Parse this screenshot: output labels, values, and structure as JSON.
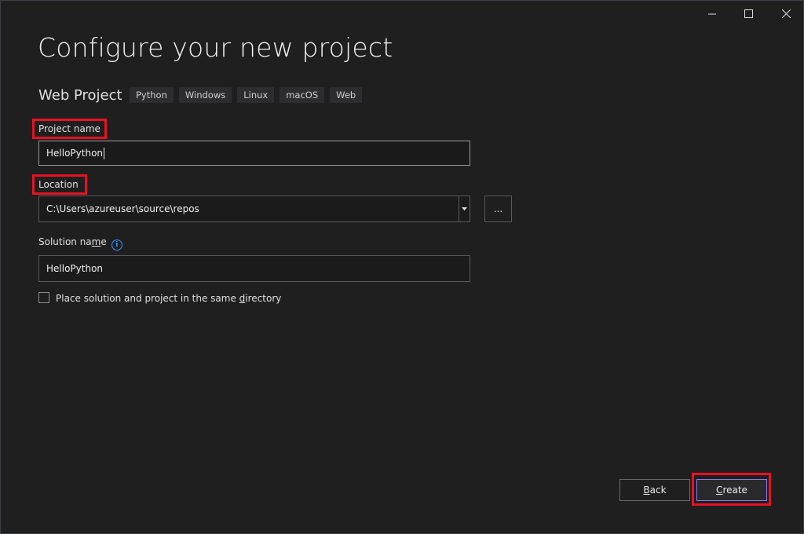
{
  "window": {
    "controls": [
      "minimize-icon",
      "maximize-icon",
      "close-icon"
    ]
  },
  "header": {
    "title": "Configure your new project",
    "template_name": "Web Project",
    "tags": [
      "Python",
      "Windows",
      "Linux",
      "macOS",
      "Web"
    ]
  },
  "form": {
    "project_name_label": "Project name",
    "project_name_value": "HelloPython",
    "location_label": "Location",
    "location_value": "C:\\Users\\azureuser\\source\\repos",
    "browse_label": "...",
    "solution_name_label_pre": "Solution na",
    "solution_name_label_ul": "m",
    "solution_name_label_post": "e",
    "solution_name_value": "HelloPython",
    "same_dir_label_pre": "Place solution and project in the same ",
    "same_dir_label_ul": "d",
    "same_dir_label_post": "irectory",
    "same_dir_checked": false
  },
  "footer": {
    "back_label_ul": "B",
    "back_label_rest": "ack",
    "create_label_ul": "C",
    "create_label_rest": "reate"
  },
  "colors": {
    "background": "#1f1f1f",
    "highlight": "#e81123",
    "accent": "#8a7cf0",
    "info": "#3794ff"
  }
}
